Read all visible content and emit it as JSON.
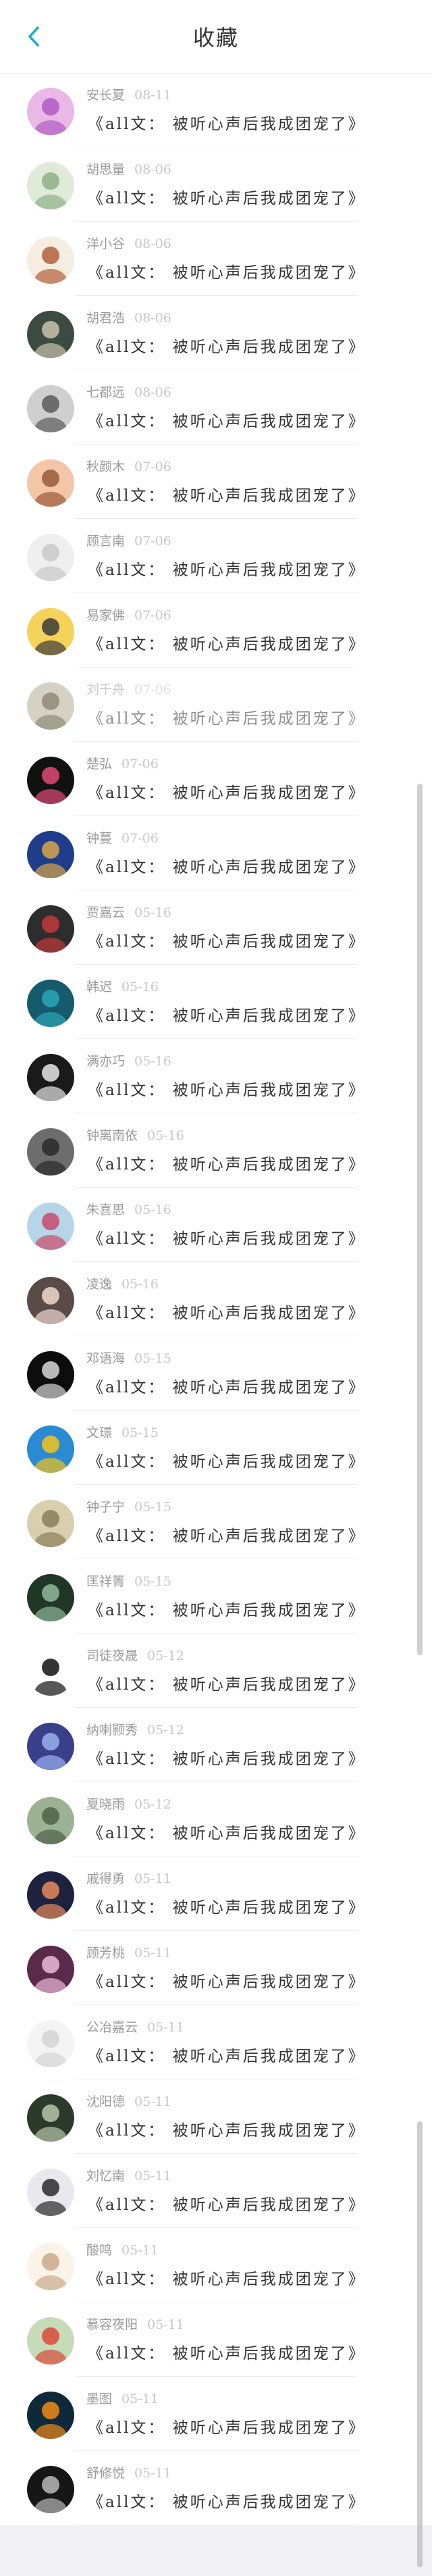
{
  "header": {
    "title": "收藏",
    "back_icon": "chevron-left-icon",
    "back_color": "#1aa7d9"
  },
  "items": [
    {
      "name": "安长夏",
      "date": "08-11",
      "text": "《all文： 被听心声后我成团宠了》",
      "bg": "#e9b8e6",
      "fg": "#b25bc4"
    },
    {
      "name": "胡思量",
      "date": "08-06",
      "text": "《all文： 被听心声后我成团宠了》",
      "bg": "#dfead8",
      "fg": "#8fb08a"
    },
    {
      "name": "洋小谷",
      "date": "08-06",
      "text": "《all文： 被听心声后我成团宠了》",
      "bg": "#f4ede0",
      "fg": "#b3603a"
    },
    {
      "name": "胡君浩",
      "date": "08-06",
      "text": "《all文： 被听心声后我成团宠了》",
      "bg": "#3b4b42",
      "fg": "#c9c2ae"
    },
    {
      "name": "七都远",
      "date": "08-06",
      "text": "《all文： 被听心声后我成团宠了》",
      "bg": "#cfcfcf",
      "fg": "#5b5b5b"
    },
    {
      "name": "秋颜木",
      "date": "07-06",
      "text": "《all文： 被听心声后我成团宠了》",
      "bg": "#f2c6a6",
      "fg": "#9a5a3a"
    },
    {
      "name": "顾言南",
      "date": "07-06",
      "text": "《all文： 被听心声后我成团宠了》",
      "bg": "#efefef",
      "fg": "#c9c9c9"
    },
    {
      "name": "易家佛",
      "date": "07-06",
      "text": "《all文： 被听心声后我成团宠了》",
      "bg": "#f5d35a",
      "fg": "#3b3b3b"
    },
    {
      "name": "刘千舟",
      "date": "07-06",
      "text": "《all文： 被听心声后我成团宠了》",
      "bg": "#d5d2c4",
      "fg": "#8e8a78",
      "faded": true
    },
    {
      "name": "楚弘",
      "date": "07-06",
      "text": "《all文： 被听心声后我成团宠了》",
      "bg": "#111111",
      "fg": "#e14a78"
    },
    {
      "name": "钟蔓",
      "date": "07-06",
      "text": "《all文： 被听心声后我成团宠了》",
      "bg": "#1f3d8a",
      "fg": "#d9a54a"
    },
    {
      "name": "贾嘉云",
      "date": "05-16",
      "text": "《all文： 被听心声后我成团宠了》",
      "bg": "#2d2d2d",
      "fg": "#c23a3a"
    },
    {
      "name": "韩迟",
      "date": "05-16",
      "text": "《all文： 被听心声后我成团宠了》",
      "bg": "#155b6b",
      "fg": "#2aa6b8"
    },
    {
      "name": "满亦巧",
      "date": "05-16",
      "text": "《all文： 被听心声后我成团宠了》",
      "bg": "#1a1a1a",
      "fg": "#e8e8e8"
    },
    {
      "name": "钟离南依",
      "date": "05-16",
      "text": "《all文： 被听心声后我成团宠了》",
      "bg": "#6d6d6d",
      "fg": "#2a2a2a"
    },
    {
      "name": "朱喜思",
      "date": "05-16",
      "text": "《all文： 被听心声后我成团宠了》",
      "bg": "#b7d5e8",
      "fg": "#c94a6a"
    },
    {
      "name": "凌逸",
      "date": "05-16",
      "text": "《all文： 被听心声后我成团宠了》",
      "bg": "#5a4a48",
      "fg": "#f0d8d0"
    },
    {
      "name": "邓语海",
      "date": "05-15",
      "text": "《all文： 被听心声后我成团宠了》",
      "bg": "#0d0d0d",
      "fg": "#d8d8d8"
    },
    {
      "name": "文璟",
      "date": "05-15",
      "text": "《all文： 被听心声后我成团宠了》",
      "bg": "#2a8ad4",
      "fg": "#f3c31a"
    },
    {
      "name": "钟子宁",
      "date": "05-15",
      "text": "《all文： 被听心声后我成团宠了》",
      "bg": "#d8cfae",
      "fg": "#8a7f5a"
    },
    {
      "name": "匡祥箐",
      "date": "05-15",
      "text": "《all文： 被听心声后我成团宠了》",
      "bg": "#203626",
      "fg": "#8fb89a"
    },
    {
      "name": "司徒夜晟",
      "date": "05-12",
      "text": "《all文： 被听心声后我成团宠了》",
      "bg": "#ffffff",
      "fg": "#111111"
    },
    {
      "name": "纳喇颢秀",
      "date": "05-12",
      "text": "《all文： 被听心声后我成团宠了》",
      "bg": "#3a3f8c",
      "fg": "#9ab0ef"
    },
    {
      "name": "夏晓雨",
      "date": "05-12",
      "text": "《all文： 被听心声后我成团宠了》",
      "bg": "#9bb392",
      "fg": "#4f6148"
    },
    {
      "name": "戚得勇",
      "date": "05-11",
      "text": "《all文： 被听心声后我成团宠了》",
      "bg": "#1d2240",
      "fg": "#e88a5a"
    },
    {
      "name": "顾芳桃",
      "date": "05-11",
      "text": "《all文： 被听心声后我成团宠了》",
      "bg": "#5a2a4a",
      "fg": "#f0b8d8"
    },
    {
      "name": "公冶嘉云",
      "date": "05-11",
      "text": "《all文： 被听心声后我成团宠了》",
      "bg": "#f4f4f4",
      "fg": "#d4d4d4"
    },
    {
      "name": "沈阳德",
      "date": "05-11",
      "text": "《all文： 被听心声后我成团宠了》",
      "bg": "#2b3a2a",
      "fg": "#b8c6a8"
    },
    {
      "name": "刘忆南",
      "date": "05-11",
      "text": "《all文： 被听心声后我成团宠了》",
      "bg": "#e8e8ee",
      "fg": "#2a2a2a"
    },
    {
      "name": "酸鸣",
      "date": "05-11",
      "text": "《all文： 被听心声后我成团宠了》",
      "bg": "#fbf3e8",
      "fg": "#caa88a"
    },
    {
      "name": "慕容夜阳",
      "date": "05-11",
      "text": "《all文： 被听心声后我成团宠了》",
      "bg": "#c6dcb8",
      "fg": "#d84a3a"
    },
    {
      "name": "墨图",
      "date": "05-11",
      "text": "《all文： 被听心声后我成团宠了》",
      "bg": "#0e2a3a",
      "fg": "#f08a1a"
    },
    {
      "name": "舒修悦",
      "date": "05-11",
      "text": "《all文： 被听心声后我成团宠了》",
      "bg": "#161616",
      "fg": "#b8b8b8"
    }
  ]
}
